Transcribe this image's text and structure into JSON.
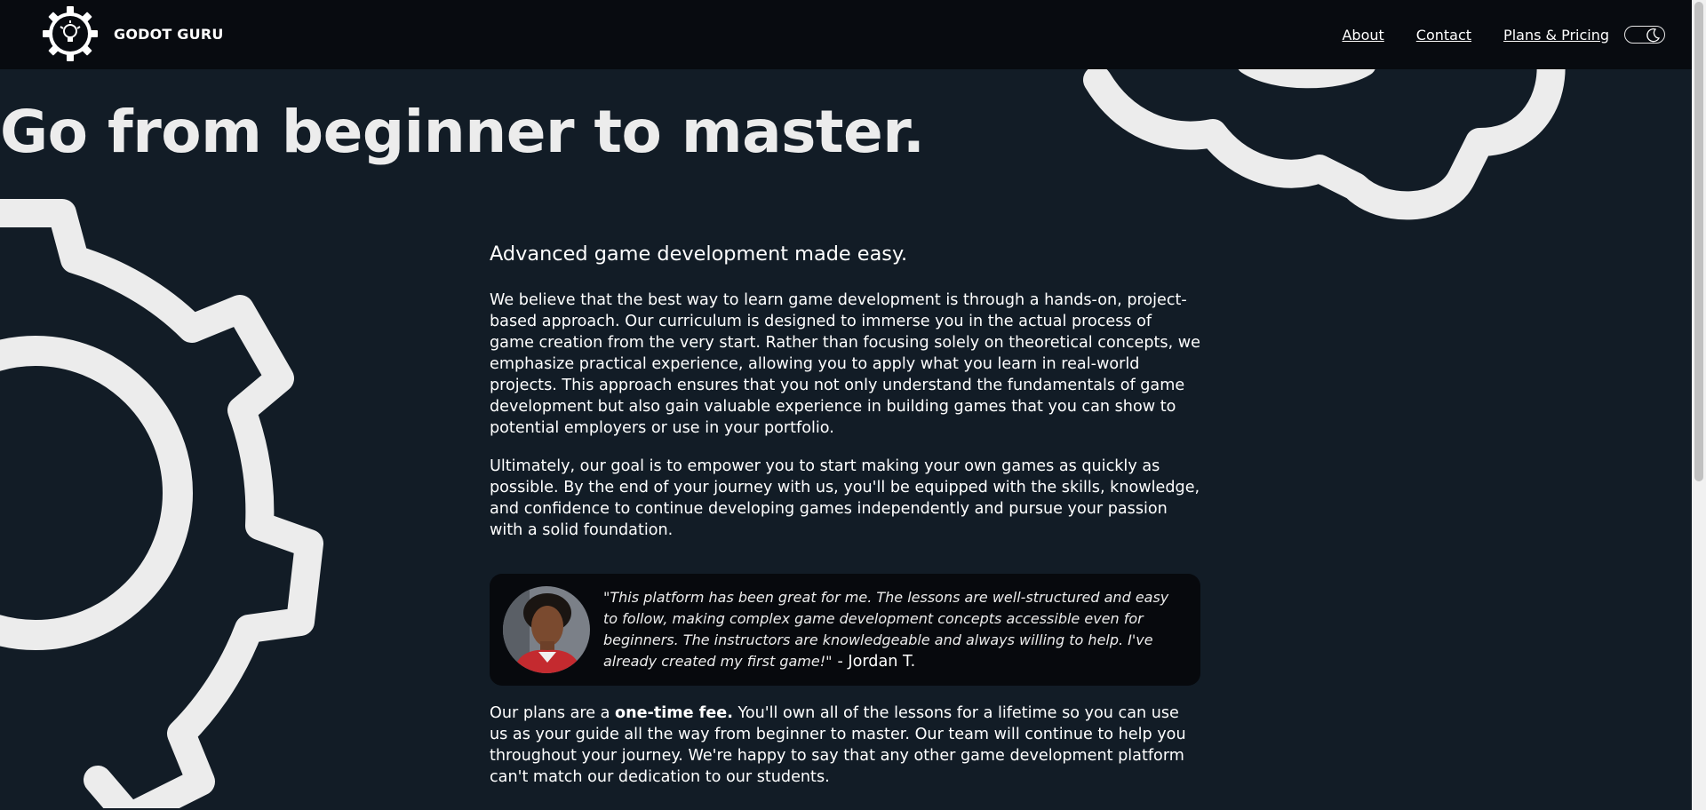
{
  "header": {
    "brand_name": "GODOT GURU",
    "nav": {
      "about": "About",
      "contact": "Contact",
      "plans": "Plans & Pricing"
    },
    "theme_icon": "moon-icon"
  },
  "hero": {
    "title": "Go from beginner to master."
  },
  "content": {
    "subtitle": "Advanced game development made easy.",
    "paragraph1": "We believe that the best way to learn game development is through a hands-on, project-based approach. Our curriculum is designed to immerse you in the actual process of game creation from the very start. Rather than focusing solely on theoretical concepts, we emphasize practical experience, allowing you to apply what you learn in real-world projects. This approach ensures that you not only understand the fundamentals of game development but also gain valuable experience in building games that you can show to potential employers or use in your portfolio.",
    "paragraph2": "Ultimately, our goal is to empower you to start making your own games as quickly as possible. By the end of your journey with us, you'll be equipped with the skills, knowledge, and confidence to continue developing games independently and pursue your passion with a solid foundation.",
    "testimonial": {
      "quote": "\"This platform has been great for me. The lessons are well-structured and easy to follow, making complex game development concepts accessible even for beginners. The instructors are knowledgeable and always willing to help. I've already created my first game!\"",
      "author": "- Jordan T."
    },
    "paragraph3": {
      "before": "Our plans are a ",
      "bold": "one-time fee.",
      "after": " You'll own all of the lessons for a lifetime so you can use us as your guide all the way from beginner to master. Our team will continue to help you throughout your journey. We're happy to say that any other game development platform can't match our dedication to our students."
    }
  },
  "colors": {
    "background": "#121c26",
    "header": "#080b10",
    "card": "#07090d",
    "gear": "#ececec"
  }
}
